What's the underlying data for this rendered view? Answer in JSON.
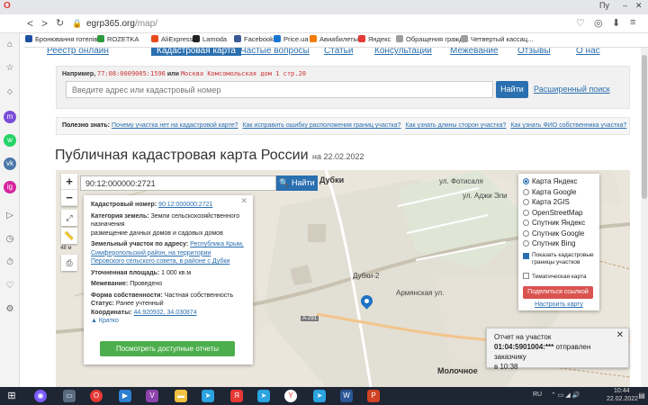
{
  "browser": {
    "tab_title": "Пу",
    "url_host": "egrp365.org",
    "url_path": "/map/",
    "bookmarks": [
      {
        "label": "Бронювання готелів",
        "color": "#1e4fa0"
      },
      {
        "label": "ROZETKA",
        "color": "#2e9a3b"
      },
      {
        "label": "AliExpress",
        "color": "#e64a19"
      },
      {
        "label": "Lamoda",
        "color": "#222222"
      },
      {
        "label": "Facebook",
        "color": "#3b5998"
      },
      {
        "label": "Price.ua",
        "color": "#1976d2"
      },
      {
        "label": "Авиабилеты",
        "color": "#f57c00"
      },
      {
        "label": "Яндекс",
        "color": "#e53935"
      },
      {
        "label": "Обращения гражд...",
        "color": "#9e9e9e"
      },
      {
        "label": "Четвертый кассац...",
        "color": "#9e9e9e"
      }
    ]
  },
  "nav": {
    "items": [
      "Реестр онлайн",
      "Кадастровая карта",
      "Частые вопросы",
      "Статьи",
      "Консультации",
      "Межевание",
      "Отзывы",
      "О нас"
    ],
    "active_index": 1
  },
  "search": {
    "example_prefix": "Например,",
    "example_code": "77:08:0009005:1596",
    "example_or": "или",
    "example_address": "Москва Комсомольская дом 1 стр.20",
    "placeholder": "Введите адрес или кадастровый номер",
    "button": "Найти",
    "advanced_link": "Расширенный поиск"
  },
  "info": {
    "label": "Полезно знать:",
    "questions": [
      "Почему участка нет на кадастровой карте?",
      "Как исправить ошибку расположения границ участка?",
      "Как узнать длины сторон участка?",
      "Как узнать ФИО собственника участка?"
    ]
  },
  "title": {
    "main": "Публичная кадастровая карта России",
    "date": "на 22.02.2022"
  },
  "map": {
    "query": "90:12:000000:2721",
    "search_button": "Найти",
    "scale": "48 м",
    "labels": {
      "dubki": "Дубки",
      "molochnoe": "Молочное",
      "armyanskaya": "Армянская ул.",
      "dubki2": "Дубки-2",
      "fotisalya": "ул. Фотисаля",
      "adzhi": "ул. Аджи Эли",
      "road": "А-291"
    }
  },
  "card": {
    "cad_label": "Кадастровый номер:",
    "cad_value": "90:12:000000:2721",
    "cat_label": "Категория земель:",
    "cat_value": "Земли сельскохозяйственного назначения",
    "use_value": "размещение дачных домов и садовых домов",
    "addr_label": "Земельный участок по адресу:",
    "addr_value": "Республика Крым, Симферопольский район, на территории Перовского сельского совета, в районе с Дубки",
    "area_label": "Уточненная площадь:",
    "area_value": "1 000 кв.м",
    "survey_label": "Межевание:",
    "survey_value": "Проведено",
    "own_label": "Форма собственности:",
    "own_value": "Частная собственность",
    "status_label": "Статус:",
    "status_value": "Ранее учтенный",
    "coords_label": "Координаты:",
    "coords_value": "44.920932, 34.030874",
    "brief": "Кратко",
    "reports_button": "Посмотреть доступные отчеты"
  },
  "layers": {
    "options": [
      "Карта Яндекс",
      "Карта Google",
      "Карта 2GIS",
      "OpenStreetMap",
      "Спутник Яндекс",
      "Спутник Google",
      "Спутник Bing"
    ],
    "selected_index": 0,
    "check_borders": "Показать кадастровые границы участков",
    "check_thematic": "Тематическая карта",
    "share_button": "Поделиться ссылкой",
    "configure_link": "Настроить карту"
  },
  "notification": {
    "title": "Отчет на участок",
    "code": "01:04:5901004:***",
    "message": " отправлен заказчику",
    "time": "в 10:38"
  },
  "taskbar": {
    "lang": "RU",
    "time": "10:44",
    "date": "22.02.2022"
  }
}
